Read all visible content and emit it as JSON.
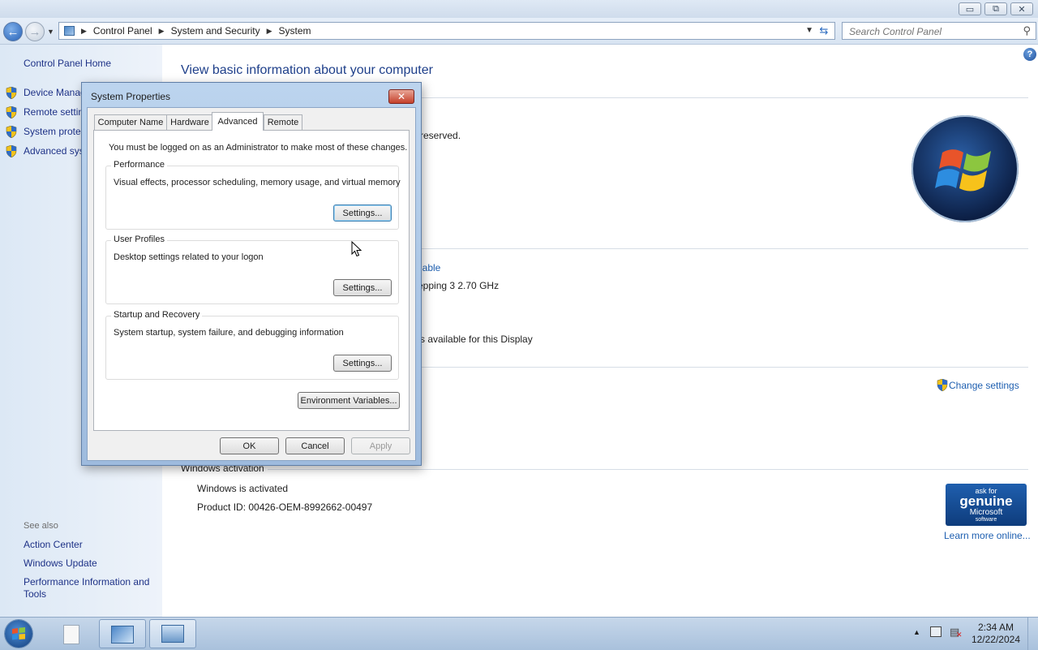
{
  "window": {
    "caption_buttons": {
      "minimize": "▭",
      "restore": "⧉",
      "close": "✕"
    }
  },
  "address_bar": {
    "crumbs": [
      "Control Panel",
      "System and Security",
      "System"
    ],
    "search_placeholder": "Search Control Panel"
  },
  "left_pane": {
    "home": "Control Panel Home",
    "links": [
      "Device Manager",
      "Remote settings",
      "System protection",
      "Advanced system settings"
    ],
    "see_also_heading": "See also",
    "see_also": [
      "Action Center",
      "Windows Update",
      "Performance Information and",
      "Tools"
    ]
  },
  "main": {
    "title": "View basic information about your computer",
    "copyright_fragment": "reserved.",
    "rating_fragment": "lable",
    "processor_fragment": "epping 3   2.70 GHz",
    "display_fragment": "s available for this Display",
    "change_settings": "Change settings",
    "activation_heading": "Windows activation",
    "activation_status": "Windows is activated",
    "product_id": "Product ID:  00426-OEM-8992662-00497",
    "genuine": {
      "line1": "ask for",
      "line2": "genuine",
      "line3": "Microsoft",
      "line4": "software"
    },
    "learn_more": "Learn more online..."
  },
  "dialog": {
    "title": "System Properties",
    "tabs": [
      "Computer Name",
      "Hardware",
      "Advanced",
      "Remote"
    ],
    "active_tab": "Advanced",
    "admin_note": "You must be logged on as an Administrator to make most of these changes.",
    "groups": [
      {
        "title": "Performance",
        "desc": "Visual effects, processor scheduling, memory usage, and virtual memory",
        "button": "Settings..."
      },
      {
        "title": "User Profiles",
        "desc": "Desktop settings related to your logon",
        "button": "Settings..."
      },
      {
        "title": "Startup and Recovery",
        "desc": "System startup, system failure, and debugging information",
        "button": "Settings..."
      }
    ],
    "env_button": "Environment Variables...",
    "ok": "OK",
    "cancel": "Cancel",
    "apply": "Apply"
  },
  "taskbar": {
    "time": "2:34 AM",
    "date": "12/22/2024"
  },
  "colors": {
    "link": "#1e3287",
    "title": "#1e3f8a",
    "accent": "#2560b6"
  }
}
